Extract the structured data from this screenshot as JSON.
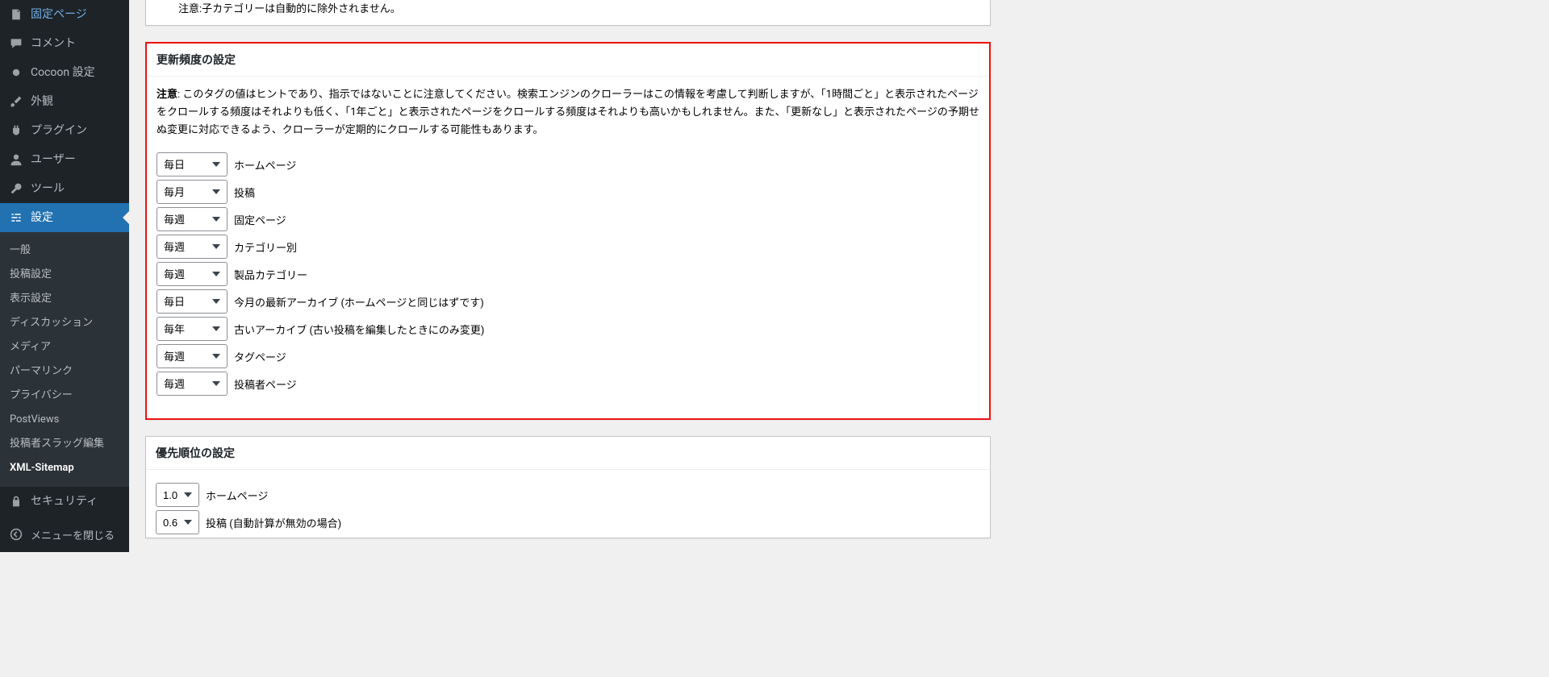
{
  "sidebar": {
    "items": [
      {
        "icon": "page",
        "label": "固定ページ"
      },
      {
        "icon": "comment",
        "label": "コメント"
      },
      {
        "icon": "cocoon",
        "label": "Cocoon 設定"
      },
      {
        "icon": "appearance",
        "label": "外観"
      },
      {
        "icon": "plugin",
        "label": "プラグイン"
      },
      {
        "icon": "user",
        "label": "ユーザー"
      },
      {
        "icon": "tool",
        "label": "ツール"
      },
      {
        "icon": "settings",
        "label": "設定",
        "active": true
      }
    ],
    "submenu": [
      "一般",
      "投稿設定",
      "表示設定",
      "ディスカッション",
      "メディア",
      "パーマリンク",
      "プライバシー",
      "PostViews",
      "投稿者スラッグ編集",
      "XML-Sitemap"
    ],
    "security": "セキュリティ",
    "collapse": "メニューを閉じる"
  },
  "top_panel_note": "注意:子カテゴリーは自動的に除外されません。",
  "freq": {
    "heading": "更新頻度の設定",
    "note_label": "注意",
    "note_body": ": このタグの値はヒントであり、指示ではないことに注意してください。検索エンジンのクローラーはこの情報を考慮して判断しますが、「1時間ごと」と表示されたページをクロールする頻度はそれよりも低く、「1年ごと」と表示されたページをクロールする頻度はそれよりも高いかもしれません。また、「更新なし」と表示されたページの予期せぬ変更に対応できるよう、クローラーが定期的にクロールする可能性もあります。",
    "rows": [
      {
        "value": "毎日",
        "label": "ホームページ"
      },
      {
        "value": "毎月",
        "label": "投稿"
      },
      {
        "value": "毎週",
        "label": "固定ページ"
      },
      {
        "value": "毎週",
        "label": "カテゴリー別"
      },
      {
        "value": "毎週",
        "label": "製品カテゴリー"
      },
      {
        "value": "毎日",
        "label": "今月の最新アーカイブ (ホームページと同じはずです)"
      },
      {
        "value": "毎年",
        "label": "古いアーカイブ (古い投稿を編集したときにのみ変更)"
      },
      {
        "value": "毎週",
        "label": "タグページ"
      },
      {
        "value": "毎週",
        "label": "投稿者ページ"
      }
    ]
  },
  "priority": {
    "heading": "優先順位の設定",
    "rows": [
      {
        "value": "1.0",
        "label": "ホームページ"
      },
      {
        "value": "0.6",
        "label": "投稿 (自動計算が無効の場合)"
      }
    ]
  }
}
